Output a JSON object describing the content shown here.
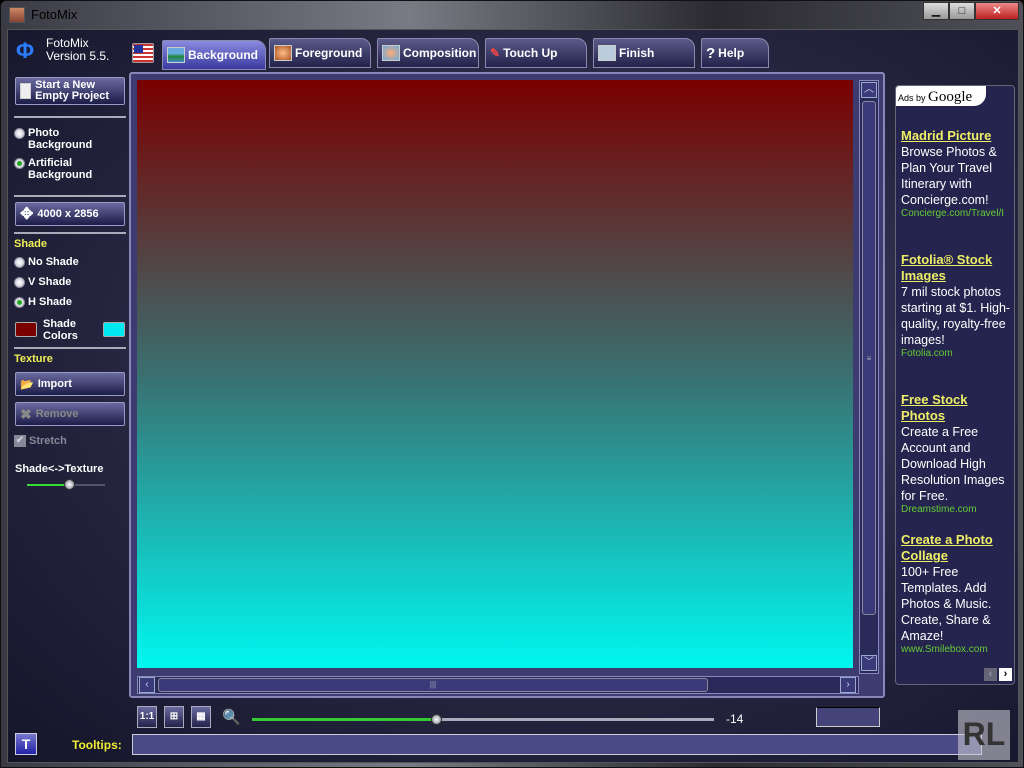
{
  "window": {
    "title": "FotoMix",
    "controls": [
      "minimize",
      "maximize",
      "close"
    ]
  },
  "app": {
    "name": "FotoMix",
    "version": "Version 5.5."
  },
  "tabs": [
    {
      "label": "Background",
      "active": true,
      "icon": "landscape-icon"
    },
    {
      "label": "Foreground",
      "icon": "face-icon"
    },
    {
      "label": "Composition",
      "icon": "face-landscape-icon"
    },
    {
      "label": "Touch Up",
      "icon": "brush-icon"
    },
    {
      "label": "Finish",
      "icon": "save-icon"
    },
    {
      "label": "Help",
      "icon": "question-icon"
    }
  ],
  "left": {
    "new_project": "Start a New Empty Project",
    "photo_bg": "Photo Background",
    "artificial_bg": "Artificial Background",
    "bg_selected": "Artificial Background",
    "size": "4000 x 2856",
    "shade_heading": "Shade",
    "shade_options": [
      "No Shade",
      "V Shade",
      "H Shade"
    ],
    "shade_selected": "H Shade",
    "shade_colors": "Shade Colors",
    "shade_color1": "#7a0000",
    "shade_color2": "#00e8f0",
    "texture_heading": "Texture",
    "import": "Import",
    "remove": "Remove",
    "stretch": "Stretch",
    "stretch_checked": true,
    "mix_label": "Shade<->Texture",
    "mix_value": 0.55
  },
  "canvas": {
    "gradient_top": "#7a0000",
    "gradient_bottom": "#00f7f0"
  },
  "ads": {
    "header": "Ads by",
    "brand": "Google",
    "items": [
      {
        "title": "Madrid Picture",
        "body": "Browse Photos & Plan Your Travel Itinerary with Concierge.com!",
        "url": "Concierge.com/Travel/I"
      },
      {
        "title": "Fotolia® Stock Images",
        "body": "7 mil stock photos starting at $1. High-quality, royalty-free images!",
        "url": "Fotolia.com"
      },
      {
        "title": "Free Stock Photos",
        "body": "Create a Free Account and Download High Resolution Images for Free.",
        "url": "Dreamstime.com"
      },
      {
        "title": "Create a Photo Collage",
        "body": "100+ Free Templates. Add Photos & Music. Create, Share & Amaze!",
        "url": "www.Smilebox.com"
      }
    ]
  },
  "bottom": {
    "one_to_one": "1:1",
    "zoom_value": "-14",
    "zoom_fraction": 0.4,
    "tooltips_label": "Tooltips:",
    "tooltips_text": "",
    "t_button": "T",
    "watermark": "RL"
  }
}
